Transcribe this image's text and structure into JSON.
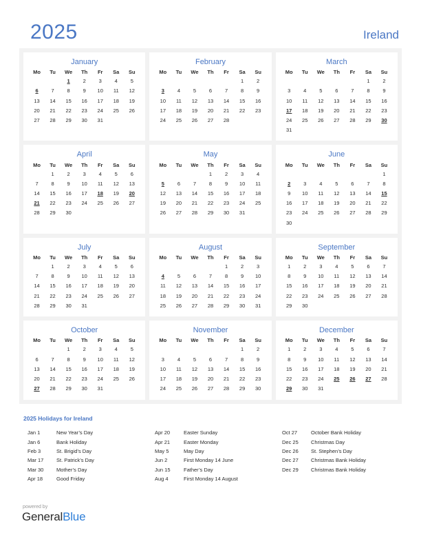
{
  "header": {
    "year": "2025",
    "country": "Ireland"
  },
  "weekdays": [
    "Mo",
    "Tu",
    "We",
    "Th",
    "Fr",
    "Sa",
    "Su"
  ],
  "colors": {
    "accent": "#4a77c4",
    "holiday": "#d60000",
    "text": "#2b2b2b",
    "panel": "#f2f2f2",
    "card": "#ffffff",
    "brand_blue": "#2f7fd8"
  },
  "months": [
    {
      "name": "January",
      "first_weekday_index": 2,
      "days_in_month": 31,
      "holidays": [
        1,
        6
      ]
    },
    {
      "name": "February",
      "first_weekday_index": 5,
      "days_in_month": 28,
      "holidays": [
        3
      ]
    },
    {
      "name": "March",
      "first_weekday_index": 5,
      "days_in_month": 31,
      "holidays": [
        17,
        30
      ]
    },
    {
      "name": "April",
      "first_weekday_index": 1,
      "days_in_month": 30,
      "holidays": [
        18,
        20,
        21
      ]
    },
    {
      "name": "May",
      "first_weekday_index": 3,
      "days_in_month": 31,
      "holidays": [
        5
      ]
    },
    {
      "name": "June",
      "first_weekday_index": 6,
      "days_in_month": 30,
      "holidays": [
        2,
        15
      ]
    },
    {
      "name": "July",
      "first_weekday_index": 1,
      "days_in_month": 31,
      "holidays": []
    },
    {
      "name": "August",
      "first_weekday_index": 4,
      "days_in_month": 31,
      "holidays": [
        4
      ]
    },
    {
      "name": "September",
      "first_weekday_index": 0,
      "days_in_month": 30,
      "holidays": []
    },
    {
      "name": "October",
      "first_weekday_index": 2,
      "days_in_month": 31,
      "holidays": [
        27
      ]
    },
    {
      "name": "November",
      "first_weekday_index": 5,
      "days_in_month": 30,
      "holidays": []
    },
    {
      "name": "December",
      "first_weekday_index": 0,
      "days_in_month": 31,
      "holidays": [
        25,
        26,
        27,
        29
      ]
    }
  ],
  "legend": {
    "title": "2025 Holidays for Ireland",
    "columns": [
      [
        {
          "date": "Jan 1",
          "name": "New Year’s Day"
        },
        {
          "date": "Jan 6",
          "name": "Bank Holiday"
        },
        {
          "date": "Feb 3",
          "name": "St. Brigid’s Day"
        },
        {
          "date": "Mar 17",
          "name": "St. Patrick’s Day"
        },
        {
          "date": "Mar 30",
          "name": "Mother’s Day"
        },
        {
          "date": "Apr 18",
          "name": "Good Friday"
        }
      ],
      [
        {
          "date": "Apr 20",
          "name": "Easter Sunday"
        },
        {
          "date": "Apr 21",
          "name": "Easter Monday"
        },
        {
          "date": "May 5",
          "name": "May Day"
        },
        {
          "date": "Jun 2",
          "name": "First Monday 14 June"
        },
        {
          "date": "Jun 15",
          "name": "Father’s Day"
        },
        {
          "date": "Aug 4",
          "name": "First Monday 14 August"
        }
      ],
      [
        {
          "date": "Oct 27",
          "name": "October Bank Holiday"
        },
        {
          "date": "Dec 25",
          "name": "Christmas Day"
        },
        {
          "date": "Dec 26",
          "name": "St. Stephen’s Day"
        },
        {
          "date": "Dec 27",
          "name": "Christmas Bank Holiday"
        },
        {
          "date": "Dec 29",
          "name": "Christmas Bank Holiday"
        }
      ]
    ]
  },
  "footer": {
    "powered_by": "powered by",
    "brand_first": "General",
    "brand_second": "Blue"
  }
}
